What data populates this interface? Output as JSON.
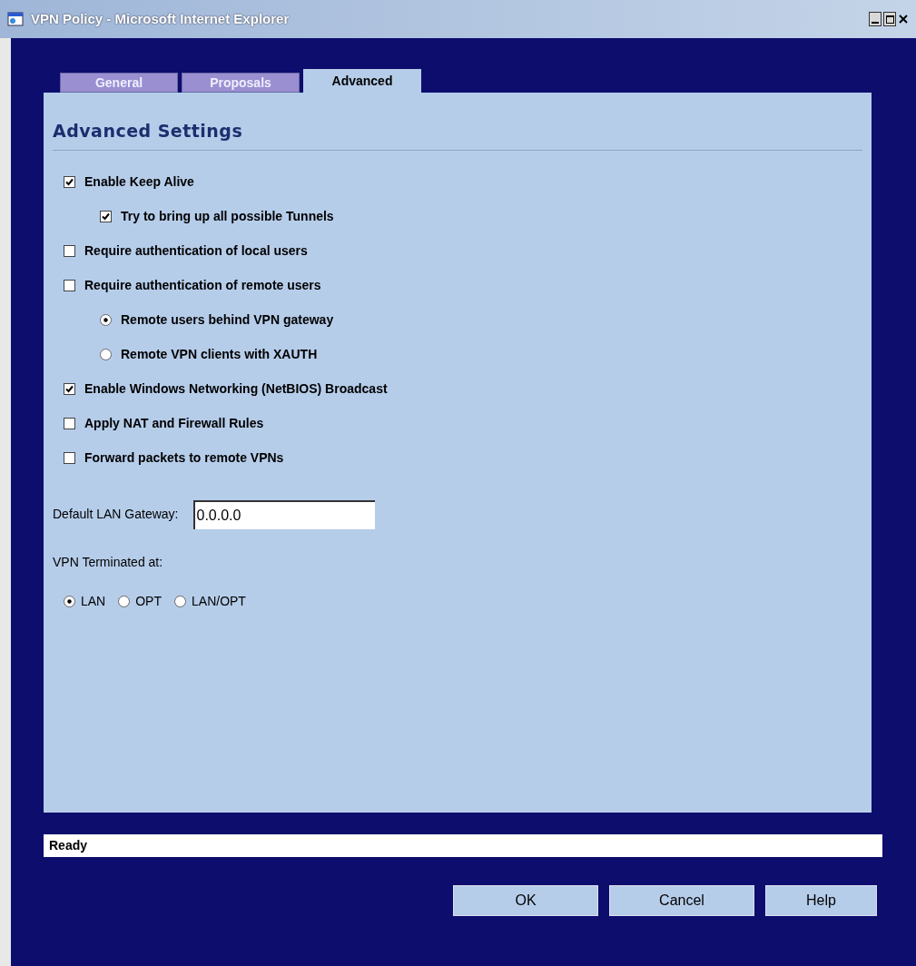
{
  "window": {
    "title": "VPN Policy - Microsoft Internet Explorer"
  },
  "tabs": [
    {
      "label": "General",
      "selected": false
    },
    {
      "label": "Proposals",
      "selected": false
    },
    {
      "label": "Advanced",
      "selected": true
    }
  ],
  "section_title": "Advanced Settings",
  "options": [
    {
      "kind": "checkbox",
      "label": "Enable Keep Alive",
      "checked": true,
      "children": [
        {
          "kind": "checkbox",
          "label": "Try to bring up all possible Tunnels",
          "checked": true
        }
      ]
    },
    {
      "kind": "checkbox",
      "label": "Require authentication of local users",
      "checked": false
    },
    {
      "kind": "checkbox",
      "label": "Require authentication of remote users",
      "checked": false,
      "children": [
        {
          "kind": "radio",
          "label": "Remote users behind VPN gateway",
          "selected": true
        },
        {
          "kind": "radio",
          "label": "Remote VPN clients with XAUTH",
          "selected": false
        }
      ]
    },
    {
      "kind": "checkbox",
      "label": "Enable Windows Networking (NetBIOS) Broadcast",
      "checked": true
    },
    {
      "kind": "checkbox",
      "label": "Apply NAT and Firewall Rules",
      "checked": false
    },
    {
      "kind": "checkbox",
      "label": "Forward packets to remote VPNs",
      "checked": false
    }
  ],
  "gateway": {
    "label": "Default LAN Gateway:",
    "value": "0.0.0.0"
  },
  "terminated": {
    "label": "VPN Terminated at:",
    "options": [
      {
        "label": "LAN",
        "selected": true
      },
      {
        "label": "OPT",
        "selected": false
      },
      {
        "label": "LAN/OPT",
        "selected": false
      }
    ]
  },
  "status_bar": "Ready",
  "buttons": [
    "OK",
    "Cancel",
    "Help"
  ]
}
